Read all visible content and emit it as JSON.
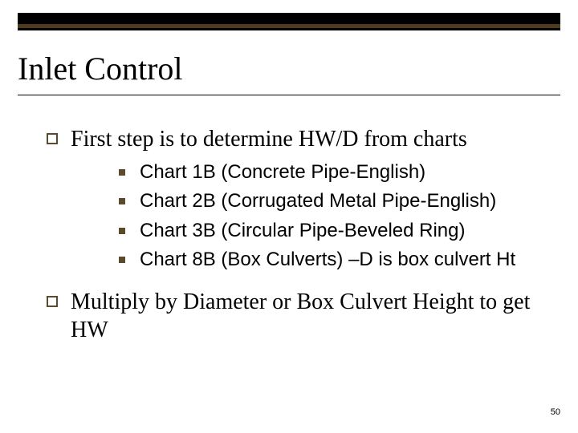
{
  "title": "Inlet Control",
  "bullets": [
    {
      "text": "First step is to determine HW/D from charts",
      "sub": [
        "Chart 1B (Concrete Pipe-English)",
        "Chart 2B (Corrugated Metal Pipe-English)",
        "Chart 3B (Circular Pipe-Beveled Ring)",
        "Chart 8B (Box Culverts) –D is box culvert Ht"
      ]
    },
    {
      "text": "Multiply by Diameter or Box Culvert Height to get HW",
      "sub": []
    }
  ],
  "page_number": "50"
}
